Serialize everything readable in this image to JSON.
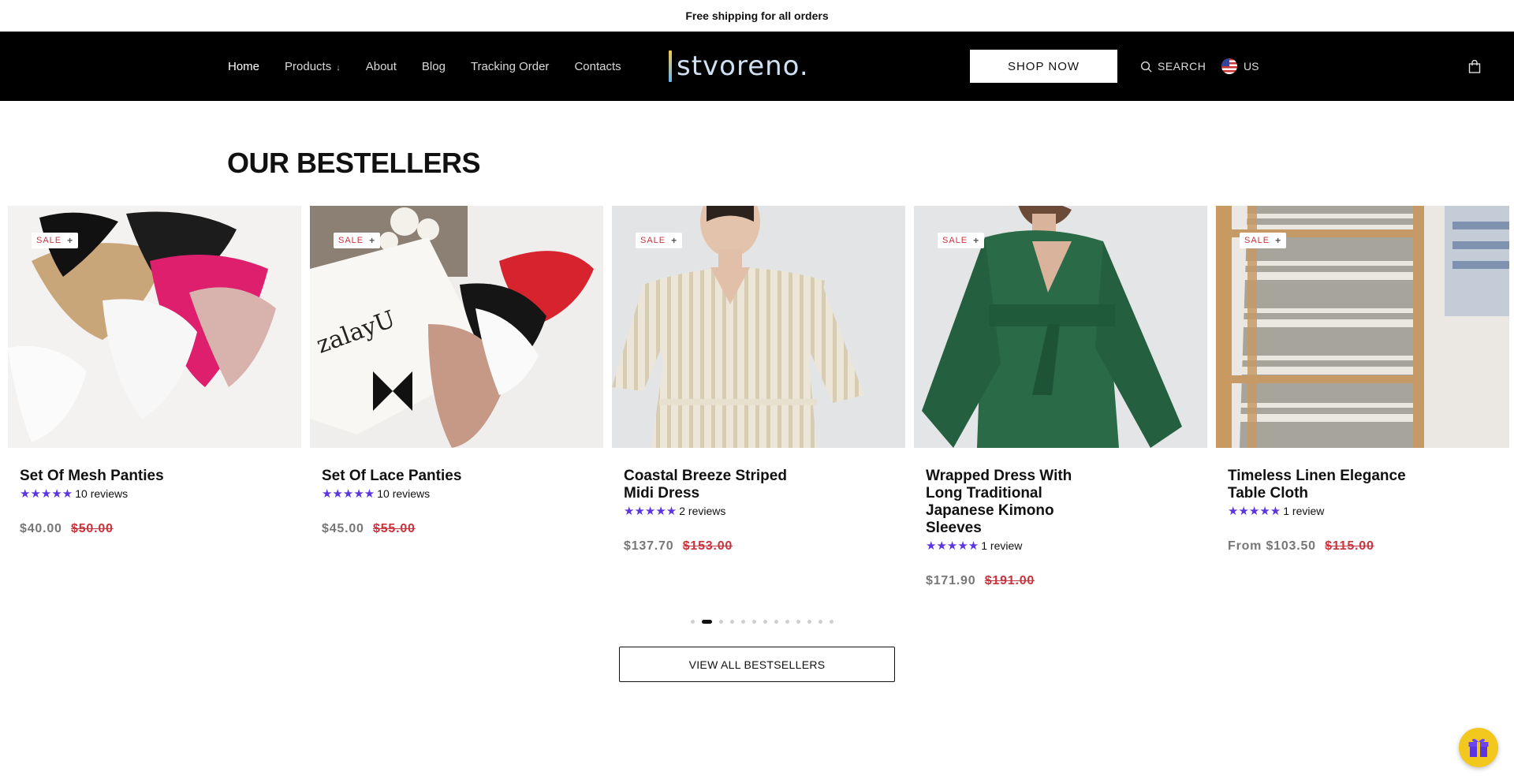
{
  "announcement": "Free shipping for all orders",
  "nav": {
    "home": "Home",
    "products": "Products",
    "about": "About",
    "blog": "Blog",
    "tracking": "Tracking Order",
    "contacts": "Contacts"
  },
  "logo": "stvoreno.",
  "header": {
    "shop_now": "SHOP NOW",
    "search": "SEARCH",
    "country": "US"
  },
  "section_title": "OUR BESTELLERS",
  "products": [
    {
      "badge": "SALE",
      "name": "Set Of Mesh Panties",
      "stars": "★★★★★",
      "reviews": "10 reviews",
      "price": "$40.00",
      "old_price": "$50.00"
    },
    {
      "badge": "SALE",
      "name": "Set Of Lace Panties",
      "stars": "★★★★★",
      "reviews": "10 reviews",
      "price": "$45.00",
      "old_price": "$55.00"
    },
    {
      "badge": "SALE",
      "name": "Coastal Breeze Striped Midi Dress",
      "stars": "★★★★★",
      "reviews": "2 reviews",
      "price": "$137.70",
      "old_price": "$153.00"
    },
    {
      "badge": "SALE",
      "name": "Wrapped Dress With Long Traditional Japanese Kimono Sleeves",
      "stars": "★★★★★",
      "reviews": "1 review",
      "price": "$171.90",
      "old_price": "$191.00"
    },
    {
      "badge": "SALE",
      "name": "Timeless Linen Elegance Table Cloth",
      "stars": "★★★★★",
      "reviews": "1 review",
      "price": "From $103.50",
      "old_price": "$115.00"
    }
  ],
  "carousel": {
    "total_dots": 13,
    "active_index": 1
  },
  "view_all": "VIEW ALL BESTSELLERS",
  "colors": {
    "header_bg": "#000000",
    "star": "#5b35e0",
    "sale": "#c9343e",
    "gift": "#f2c81f"
  }
}
